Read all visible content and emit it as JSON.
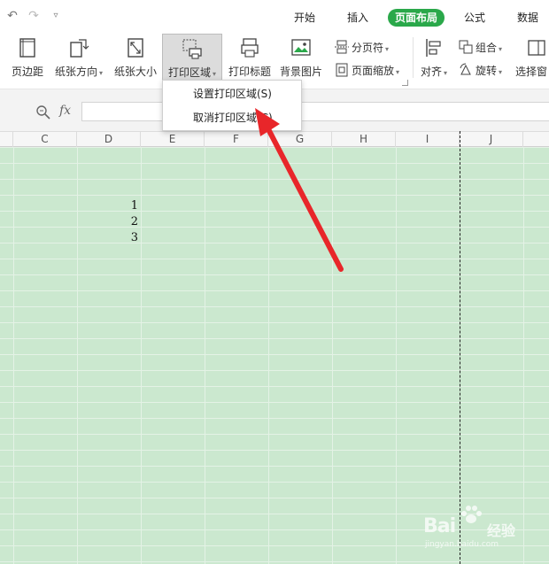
{
  "tabs": [
    "开始",
    "插入",
    "页面布局",
    "公式",
    "数据"
  ],
  "ribbon": {
    "margins": "页边距",
    "orientation": "纸张方向",
    "size": "纸张大小",
    "print_area": "打印区域",
    "print_titles": "打印标题",
    "background": "背景图片",
    "page_break": "分页符",
    "page_zoom": "页面缩放",
    "align": "对齐",
    "group": "组合",
    "rotate": "旋转",
    "selection_pane": "选择窗"
  },
  "print_area_menu": {
    "set": "设置打印区域(S)",
    "cancel": "取消打印区域(C)"
  },
  "formula_bar": {
    "fx": "fx",
    "value": ""
  },
  "columns": [
    "C",
    "D",
    "E",
    "F",
    "G",
    "H",
    "I",
    "J"
  ],
  "cells": [
    "1",
    "2",
    "3"
  ],
  "watermark": {
    "logo": "Bai",
    "logo2": "经验",
    "sub": "jingyan.baidu.com"
  },
  "colors": {
    "accent": "#2aa84a",
    "grid_bg": "#cbe8cf",
    "arrow": "#e8262a"
  }
}
